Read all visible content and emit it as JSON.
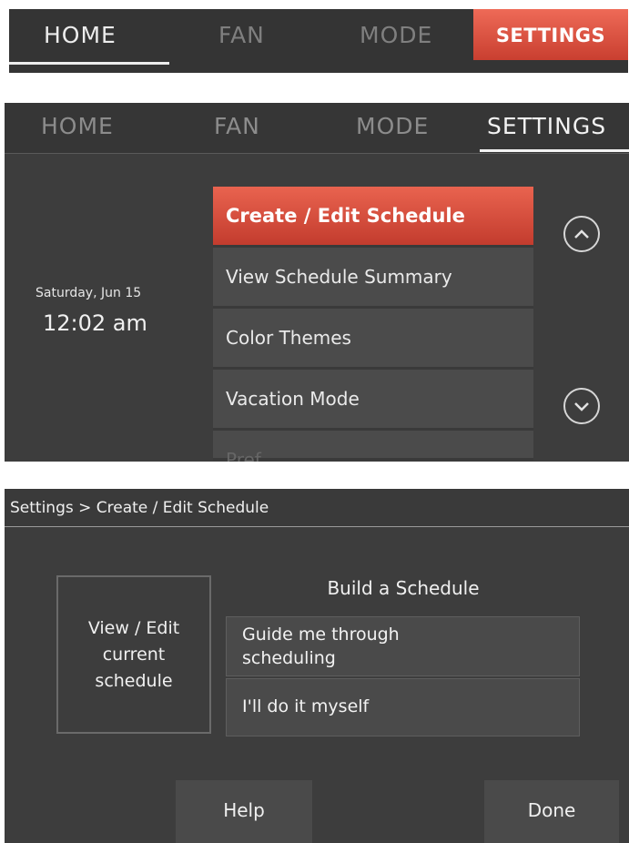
{
  "panel1": {
    "tabs": {
      "home": "HOME",
      "fan": "FAN",
      "mode": "MODE",
      "settings": "SETTINGS"
    }
  },
  "panel2": {
    "tabs": {
      "home": "HOME",
      "fan": "FAN",
      "mode": "MODE",
      "settings": "SETTINGS"
    },
    "date": "Saturday, Jun 15",
    "time": "12:02 am",
    "menu": {
      "create_edit": "Create / Edit Schedule",
      "view_summary": "View Schedule Summary",
      "color_themes": "Color Themes",
      "vacation_mode": "Vacation Mode",
      "partial": "Pref..."
    },
    "icons": {
      "up": "chevron-up-icon",
      "down": "chevron-down-icon"
    },
    "colors": {
      "accent": "#d9503f",
      "background": "#3d3d3d"
    }
  },
  "panel3": {
    "breadcrumb": "Settings > Create / Edit Schedule",
    "view_edit": {
      "line1": "View / Edit",
      "line2": "current",
      "line3": "schedule"
    },
    "build_title": "Build a Schedule",
    "guide": "Guide me through scheduling",
    "self": "I'll do it myself",
    "help": "Help",
    "done": "Done"
  }
}
